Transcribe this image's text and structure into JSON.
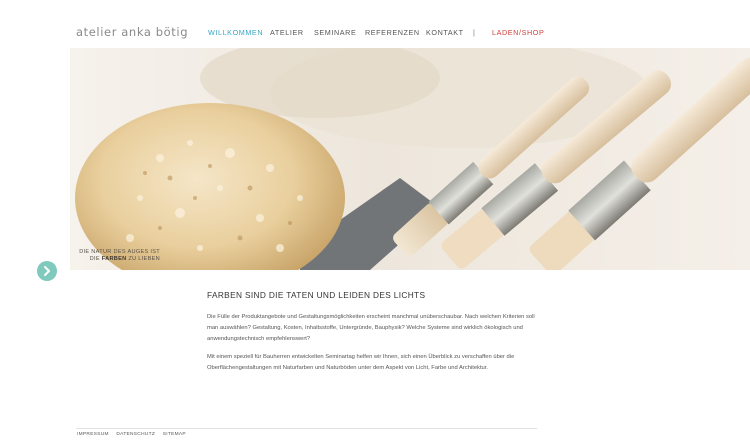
{
  "header": {
    "logo": "atelier anka bötig",
    "nav": [
      {
        "label": "WILLKOMMEN",
        "state": "active"
      },
      {
        "label": "ATELIER"
      },
      {
        "label": "SEMINARE"
      },
      {
        "label": "REFERENZEN"
      },
      {
        "label": "KONTAKT"
      }
    ],
    "separator": "|",
    "shop_label": "LADEN/SHOP"
  },
  "hero": {
    "caption_line1": "DIE NATUR DES AUGES IST",
    "caption_line2_pre": "DIE ",
    "caption_line2_bold": "FARBEN",
    "caption_line2_post": " ZU LIEBEN"
  },
  "content": {
    "heading": "FARBEN SIND DIE TATEN UND LEIDEN DES LICHTS",
    "paragraphs": [
      "Die Fülle der Produktangebote und Gestaltungsmöglichkeiten erscheint manchmal unüberschaubar. Nach welchen Kriterien soll man auswählen? Gestaltung, Kosten, Inhaltsstoffe, Untergründe, Bauphysik? Welche Systeme sind wirklich ökologisch und anwendungstechnisch empfehlenswert?",
      "Mit einem speziell für Bauherren entwickelten Seminartag helfen wir Ihnen, sich einen Überblick zu verschaffen über die Oberflächengestaltungen mit Naturfarben und Naturböden unter dem Aspekt von Licht, Farbe und Architektur."
    ]
  },
  "footer": {
    "links": [
      "IMPRESSUM",
      "DATENSCHUTZ",
      "SITEMAP"
    ]
  },
  "colors": {
    "accent_blue": "#3ba5c4",
    "shop_red": "#d2413b",
    "arrow_teal": "#7fcabd"
  },
  "icons": {
    "next_slide": "chevron-right-icon"
  }
}
